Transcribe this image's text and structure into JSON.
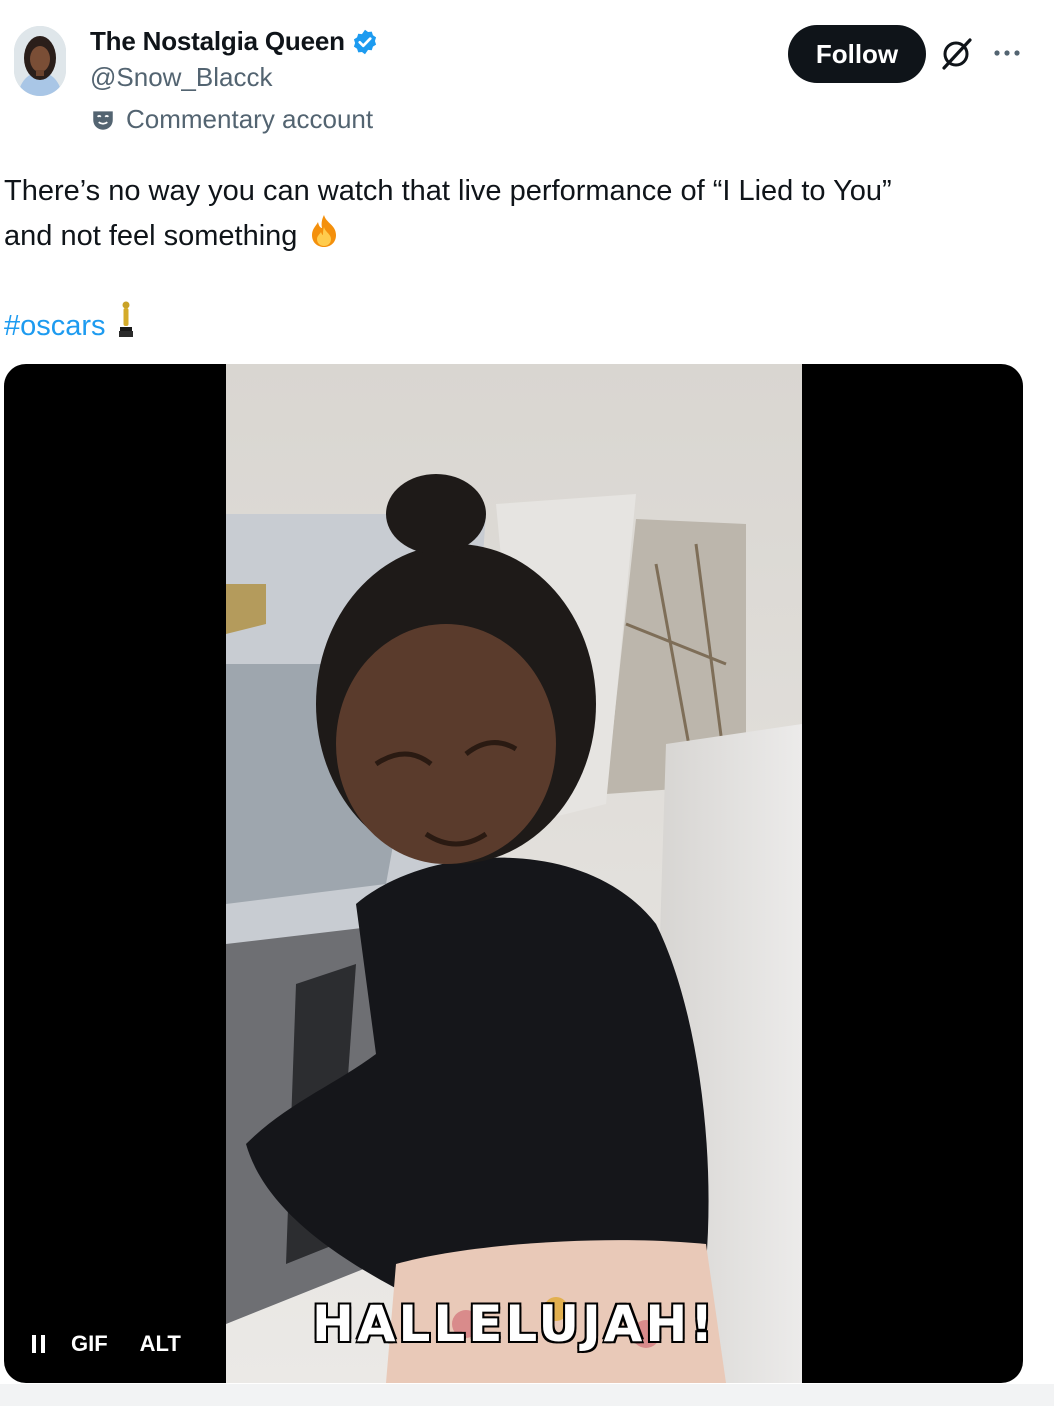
{
  "author": {
    "display_name": "The Nostalgia Queen",
    "handle": "@Snow_Blacck",
    "account_label": "Commentary account",
    "verified": true
  },
  "actions": {
    "follow_label": "Follow"
  },
  "tweet": {
    "text_line1": "There’s no way you can watch that live performance of “I Lied to You”",
    "text_line2": "and not feel something",
    "hashtag": "#oscars"
  },
  "media": {
    "overlay_caption": "HALLELUJAH!",
    "gif_badge": "GIF",
    "alt_label": "ALT",
    "playing": true
  },
  "colors": {
    "link": "#1d9bf0",
    "verified": "#1d9bf0",
    "primary_text": "#0f1419",
    "secondary_text": "#536471"
  },
  "icons": [
    "verified-badge-icon",
    "commentary-mask-icon",
    "grok-icon",
    "more-icon",
    "fire-emoji",
    "oscar-emoji",
    "pause-icon"
  ]
}
